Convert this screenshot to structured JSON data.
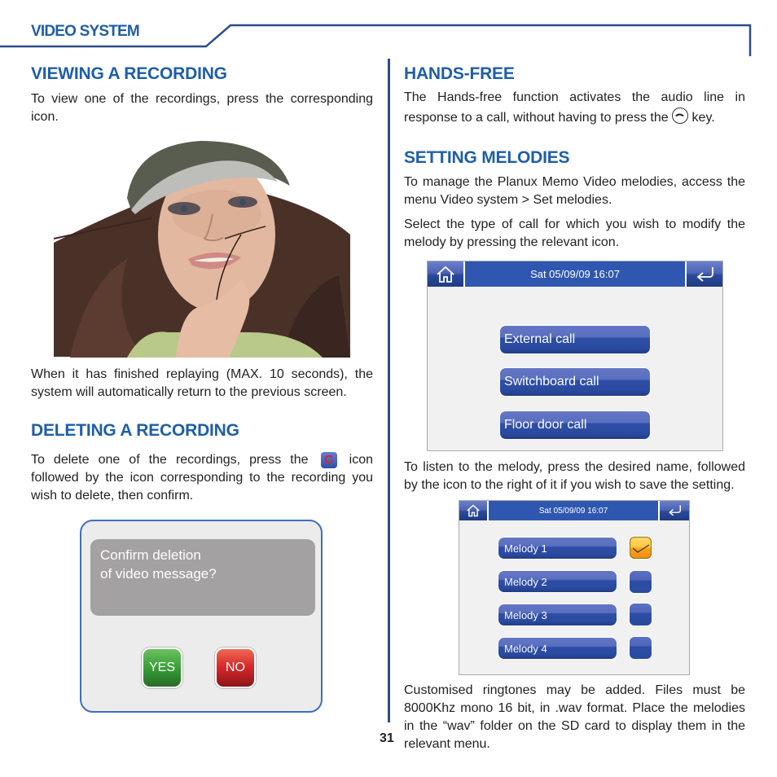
{
  "header": {
    "section_title": "VIDEO SYSTEM"
  },
  "left": {
    "viewing": {
      "title": "VIEWING A RECORDING",
      "text": "To view one of the recordings, press the corresponding icon.",
      "after_photo": "When it has finished replaying (MAX. 10 seconds), the system will automatically return to the previous screen."
    },
    "deleting": {
      "title": "DELETING A RECORDING",
      "text_before_icon": "To delete one of the recordings, press the",
      "icon": "delete-c-icon",
      "icon_glyph": "C",
      "text_after_icon": "icon followed by the icon corresponding to the recording you wish to delete, then confirm."
    },
    "dialog": {
      "message_line1": "Confirm deletion",
      "message_line2": "of video message?",
      "yes_label": "YES",
      "no_label": "NO"
    }
  },
  "right": {
    "hands_free": {
      "title": "HANDS-FREE",
      "text_before_icon": "The Hands-free function activates the audio line in response to a call, without having to press the",
      "icon": "handset-icon",
      "text_after_icon": "key."
    },
    "melodies": {
      "title": "SETTING MELODIES",
      "p1": "To manage the Planux Memo Video melodies, access the menu Video system > Set melodies.",
      "p2": "Select the type of call for which you wish to modify the melody by pressing the relevant icon.",
      "p3": "To listen to the melody, press the desired name, followed by the icon to the right of it if you wish to save the setting.",
      "p4": "Customised ringtones may be added. Files must be 8000Khz mono 16 bit, in .wav format. Place the melodies in the “wav” folder on the SD card to display them in the relevant menu."
    },
    "screen1": {
      "datetime": "Sat 05/09/09 16:07",
      "buttons": [
        "External call",
        "Switchboard call",
        "Floor door call"
      ]
    },
    "screen2": {
      "datetime": "Sat 05/09/09 16:07",
      "melodies": [
        {
          "label": "Melody 1",
          "selected": true
        },
        {
          "label": "Melody 2",
          "selected": false
        },
        {
          "label": "Melody 3",
          "selected": false
        },
        {
          "label": "Melody 4",
          "selected": false
        }
      ]
    }
  },
  "page_number": "31",
  "colors": {
    "accent": "#1f5ea8",
    "screen_bar": "#2f57b0",
    "yes": "#3da33c",
    "no": "#d92a2a",
    "selected": "#f7a21c"
  }
}
